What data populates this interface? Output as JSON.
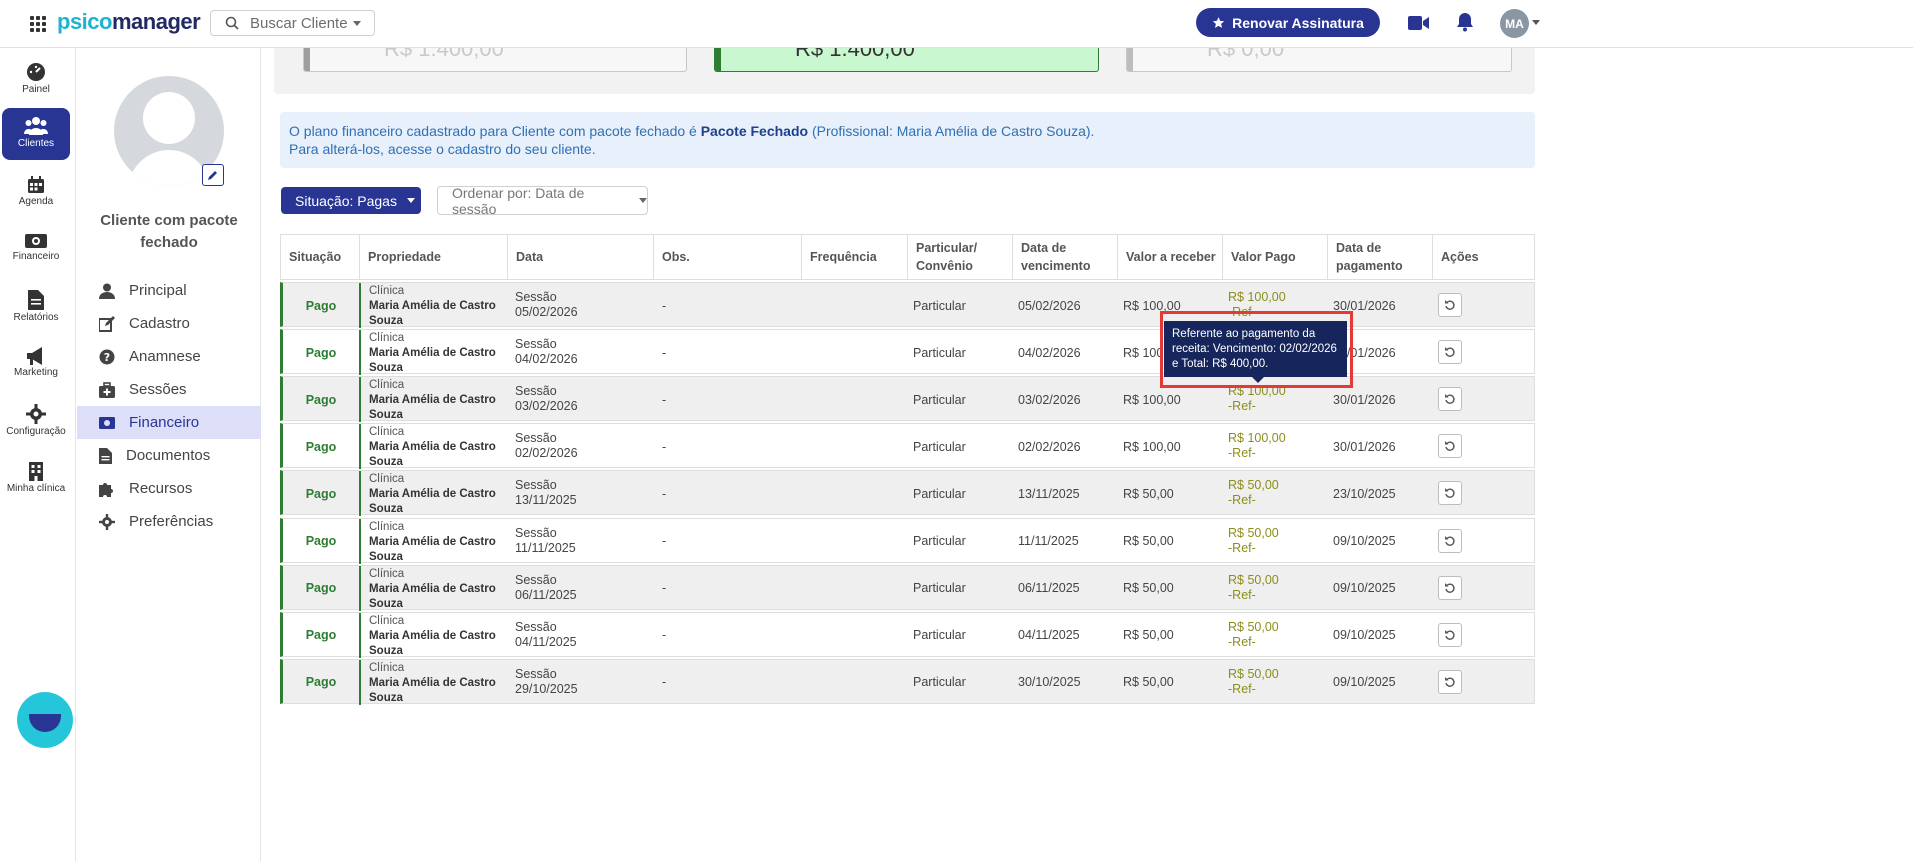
{
  "header": {
    "logo_part1": "psico",
    "logo_part2": "manager",
    "search_placeholder": "Buscar Cliente",
    "renew_label": "Renovar Assinatura",
    "avatar_initials": "MA"
  },
  "rail": {
    "items": [
      {
        "label": "Painel"
      },
      {
        "label": "Clientes"
      },
      {
        "label": "Agenda"
      },
      {
        "label": "Financeiro"
      },
      {
        "label": "Relatórios"
      },
      {
        "label": "Marketing"
      },
      {
        "label": "Configuração"
      },
      {
        "label": "Minha clínica"
      }
    ]
  },
  "profile": {
    "name": "Cliente com pacote fechado",
    "menu": [
      {
        "label": "Principal"
      },
      {
        "label": "Cadastro"
      },
      {
        "label": "Anamnese"
      },
      {
        "label": "Sessões"
      },
      {
        "label": "Financeiro"
      },
      {
        "label": "Documentos"
      },
      {
        "label": "Recursos"
      },
      {
        "label": "Preferências"
      }
    ]
  },
  "summary": {
    "boxes": [
      {
        "value": "R$ 1.400,00",
        "accent": "#9e9e9e",
        "bg": "#f7f7f7"
      },
      {
        "value": "R$ 1.400,00",
        "accent": "#2e7d32",
        "bg": "#c9f7cf"
      },
      {
        "value": "R$ 0,00",
        "accent": "#bdbdbd",
        "bg": "#f7f7f7"
      }
    ]
  },
  "info": {
    "line1_prefix": "O plano financeiro cadastrado para Cliente com pacote fechado é ",
    "line1_plan": "Pacote Fechado",
    "line1_suffix": " (Profissional: Maria Amélia de Castro Souza).",
    "line2": "Para alterá-los, acesse o cadastro do seu cliente."
  },
  "filters": {
    "situacao": "Situação: Pagas",
    "ordenar": "Ordenar por: Data de sessão"
  },
  "table": {
    "headers": [
      "Situação",
      "Propriedade",
      "Data",
      "Obs.",
      "Frequência",
      "Particular/ Convênio",
      "Data de vencimento",
      "Valor a receber",
      "Valor Pago",
      "Data de pagamento",
      "Ações"
    ],
    "rows": [
      {
        "status": "Pago",
        "prop_type": "Clínica",
        "prop_name": "Maria Amélia de Castro Souza",
        "data_kind": "Sessão",
        "data_date": "05/02/2026",
        "obs": "-",
        "part": "Particular",
        "venc": "05/02/2026",
        "vrec": "R$ 100,00",
        "vpago": "R$ 100,00",
        "ref": "-Ref-",
        "dpag": "30/01/2026"
      },
      {
        "status": "Pago",
        "prop_type": "Clínica",
        "prop_name": "Maria Amélia de Castro Souza",
        "data_kind": "Sessão",
        "data_date": "04/02/2026",
        "obs": "-",
        "part": "Particular",
        "venc": "04/02/2026",
        "vrec": "R$ 100,00",
        "vpago": "",
        "ref": "",
        "dpag": "30/01/2026"
      },
      {
        "status": "Pago",
        "prop_type": "Clínica",
        "prop_name": "Maria Amélia de Castro Souza",
        "data_kind": "Sessão",
        "data_date": "03/02/2026",
        "obs": "-",
        "part": "Particular",
        "venc": "03/02/2026",
        "vrec": "R$ 100,00",
        "vpago": "R$ 100,00",
        "ref": "-Ref-",
        "dpag": "30/01/2026"
      },
      {
        "status": "Pago",
        "prop_type": "Clínica",
        "prop_name": "Maria Amélia de Castro Souza",
        "data_kind": "Sessão",
        "data_date": "02/02/2026",
        "obs": "-",
        "part": "Particular",
        "venc": "02/02/2026",
        "vrec": "R$ 100,00",
        "vpago": "R$ 100,00",
        "ref": "-Ref-",
        "dpag": "30/01/2026"
      },
      {
        "status": "Pago",
        "prop_type": "Clínica",
        "prop_name": "Maria Amélia de Castro Souza",
        "data_kind": "Sessão",
        "data_date": "13/11/2025",
        "obs": "-",
        "part": "Particular",
        "venc": "13/11/2025",
        "vrec": "R$ 50,00",
        "vpago": "R$ 50,00",
        "ref": "-Ref-",
        "dpag": "23/10/2025"
      },
      {
        "status": "Pago",
        "prop_type": "Clínica",
        "prop_name": "Maria Amélia de Castro Souza",
        "data_kind": "Sessão",
        "data_date": "11/11/2025",
        "obs": "-",
        "part": "Particular",
        "venc": "11/11/2025",
        "vrec": "R$ 50,00",
        "vpago": "R$ 50,00",
        "ref": "-Ref-",
        "dpag": "09/10/2025"
      },
      {
        "status": "Pago",
        "prop_type": "Clínica",
        "prop_name": "Maria Amélia de Castro Souza",
        "data_kind": "Sessão",
        "data_date": "06/11/2025",
        "obs": "-",
        "part": "Particular",
        "venc": "06/11/2025",
        "vrec": "R$ 50,00",
        "vpago": "R$ 50,00",
        "ref": "-Ref-",
        "dpag": "09/10/2025"
      },
      {
        "status": "Pago",
        "prop_type": "Clínica",
        "prop_name": "Maria Amélia de Castro Souza",
        "data_kind": "Sessão",
        "data_date": "04/11/2025",
        "obs": "-",
        "part": "Particular",
        "venc": "04/11/2025",
        "vrec": "R$ 50,00",
        "vpago": "R$ 50,00",
        "ref": "-Ref-",
        "dpag": "09/10/2025"
      },
      {
        "status": "Pago",
        "prop_type": "Clínica",
        "prop_name": "Maria Amélia de Castro Souza",
        "data_kind": "Sessão",
        "data_date": "29/10/2025",
        "obs": "-",
        "part": "Particular",
        "venc": "30/10/2025",
        "vrec": "R$ 50,00",
        "vpago": "R$ 50,00",
        "ref": "-Ref-",
        "dpag": "09/10/2025"
      }
    ]
  },
  "tooltip": {
    "line1": "Referente ao pagamento da",
    "line2": "receita: Vencimento: 02/02/2026",
    "line3": "e Total: R$ 400,00."
  }
}
